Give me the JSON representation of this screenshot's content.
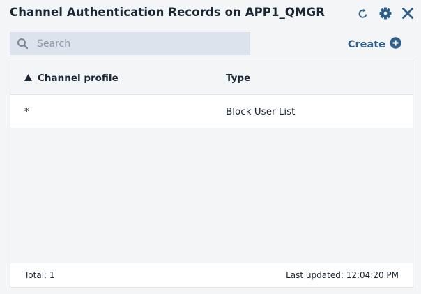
{
  "header": {
    "title": "Channel Authentication Records on APP1_QMGR",
    "icons": [
      "refresh-icon",
      "gear-icon",
      "close-icon"
    ],
    "icon_color": "#2e5f8c"
  },
  "search": {
    "placeholder": "Search",
    "value": ""
  },
  "create": {
    "label": "Create",
    "icon": "plus-circle-icon"
  },
  "table": {
    "columns": [
      {
        "label": "Channel profile",
        "sort": "ascending"
      },
      {
        "label": "Type"
      }
    ],
    "rows": [
      {
        "channel_profile": "*",
        "type": "Block User List"
      }
    ]
  },
  "footer": {
    "total": "Total: 1",
    "last_updated": "Last updated: 12:04:20 PM"
  }
}
